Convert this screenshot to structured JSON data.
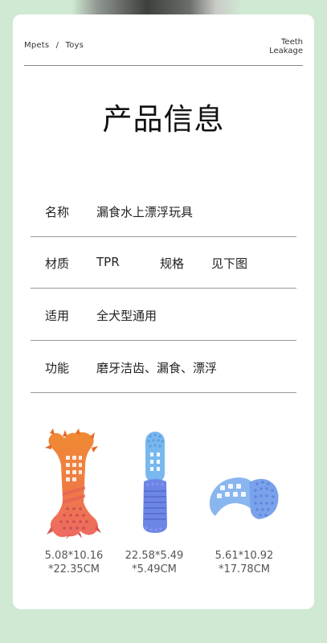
{
  "header": {
    "brand": "Mpets",
    "separator": "/",
    "category": "Toys",
    "tagline_line1": "Teeth",
    "tagline_line2": "Leakage"
  },
  "title": "产品信息",
  "specs": [
    {
      "label": "名称",
      "value": "漏食水上漂浮玩具"
    },
    {
      "label": "材质",
      "value": "TPR",
      "label2": "规格",
      "value2": "见下图"
    },
    {
      "label": "适用",
      "value": "全犬型通用"
    },
    {
      "label": "功能",
      "value": "磨牙洁齿、漏食、漂浮"
    }
  ],
  "products": [
    {
      "icon": "bone-toy-icon",
      "dim_line1": "5.08*10.16",
      "dim_line2": "*22.35CM"
    },
    {
      "icon": "stick-toy-icon",
      "dim_line1": "22.58*5.49",
      "dim_line2": "*5.49CM"
    },
    {
      "icon": "curved-toy-icon",
      "dim_line1": "5.61*10.92",
      "dim_line2": "*17.78CM"
    }
  ],
  "colors": {
    "background": "#cfe9d3",
    "card": "#ffffff",
    "bone_orange": "#ef8a3c",
    "bone_red": "#ee6a64",
    "stick_light_blue": "#79b8ee",
    "stick_dark_blue": "#6d86e6",
    "curved_blue": "#8ab6f0"
  }
}
